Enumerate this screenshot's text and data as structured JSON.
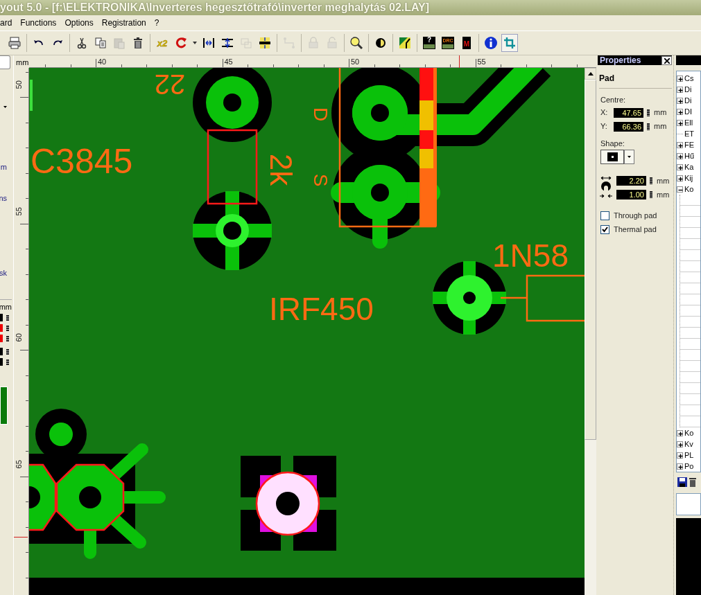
{
  "window": {
    "title": "yout 5.0 - [f:\\ELEKTRONIKA\\Inverteres hegesztőtrafó\\inverter meghalytás 02.LAY]"
  },
  "menu": [
    "ard",
    "Functions",
    "Options",
    "Registration",
    "?"
  ],
  "toolbar": {
    "groups": [
      [
        {
          "kind": "print",
          "disabled": false,
          "selected": false
        }
      ],
      [
        {
          "kind": "undo",
          "disabled": false,
          "selected": false
        },
        {
          "kind": "redo",
          "disabled": false,
          "selected": false
        }
      ],
      [
        {
          "kind": "cut",
          "disabled": false,
          "selected": false
        },
        {
          "kind": "copy",
          "disabled": false,
          "selected": false
        },
        {
          "kind": "paste",
          "disabled": true,
          "selected": false
        },
        {
          "kind": "delete",
          "disabled": false,
          "selected": false
        }
      ],
      [
        {
          "kind": "double",
          "label": "x2",
          "disabled": false,
          "selected": false
        },
        {
          "kind": "rotate",
          "disabled": false,
          "selected": false
        },
        {
          "kind": "caret",
          "disabled": false,
          "selected": false
        },
        {
          "kind": "mirror",
          "disabled": false,
          "selected": false
        },
        {
          "kind": "spread",
          "disabled": false,
          "selected": false
        },
        {
          "kind": "group",
          "disabled": true,
          "selected": false
        },
        {
          "kind": "fit",
          "disabled": false,
          "selected": false
        }
      ],
      [
        {
          "kind": "route",
          "disabled": true,
          "selected": false
        }
      ],
      [
        {
          "kind": "lock",
          "disabled": true,
          "selected": false
        },
        {
          "kind": "unlock",
          "disabled": true,
          "selected": false
        }
      ],
      [
        {
          "kind": "zoom",
          "disabled": false,
          "selected": false
        }
      ],
      [
        {
          "kind": "contrast",
          "disabled": false,
          "selected": false
        }
      ],
      [
        {
          "kind": "autoroute",
          "disabled": false,
          "selected": false
        }
      ],
      [
        {
          "kind": "test",
          "label": "?",
          "disabled": false,
          "selected": false
        },
        {
          "kind": "drc",
          "label": "DRC",
          "disabled": false,
          "selected": false
        },
        {
          "kind": "macro",
          "label": "M",
          "disabled": false,
          "selected": false
        }
      ],
      [
        {
          "kind": "info",
          "disabled": false,
          "selected": false
        },
        {
          "kind": "crop",
          "disabled": false,
          "selected": true
        }
      ]
    ]
  },
  "left_panel": {
    "texts": [
      "m",
      "ns",
      "sk"
    ],
    "unit": "mm"
  },
  "horizontal_ruler": {
    "unit": "mm",
    "labels": [
      "40",
      "45",
      "50",
      "55"
    ]
  },
  "vertical_ruler": {
    "labels": [
      "50",
      "55",
      "60",
      "65"
    ]
  },
  "board": {
    "labels": [
      {
        "text": "22"
      },
      {
        "text": "C3845"
      },
      {
        "text": "2k"
      },
      {
        "text": "D"
      },
      {
        "text": "S"
      },
      {
        "text": "IRF450"
      },
      {
        "text": "1N58"
      }
    ]
  },
  "properties": {
    "title": "Properties",
    "heading": "Pad",
    "centre_label": "Centre:",
    "x_label": "X:",
    "x_value": "47.65",
    "x_unit": "mm",
    "y_label": "Y:",
    "y_value": "66.36",
    "y_unit": "mm",
    "shape_label": "Shape:",
    "diameter_value": "2.20",
    "diameter_unit": "mm",
    "hole_value": "1.00",
    "hole_unit": "mm",
    "checkboxes": [
      {
        "label": "Through pad",
        "checked": false
      },
      {
        "label": "Thermal pad",
        "checked": true
      }
    ]
  },
  "library_tree": {
    "items": [
      {
        "label": "Cs",
        "kind": "folder",
        "expanded": false
      },
      {
        "label": "Di",
        "kind": "folder",
        "expanded": false
      },
      {
        "label": "Di",
        "kind": "folder",
        "expanded": false
      },
      {
        "label": "DI",
        "kind": "folder",
        "expanded": false
      },
      {
        "label": "Ell",
        "kind": "folder",
        "expanded": false
      },
      {
        "label": "ET",
        "kind": "leaf",
        "expanded": false
      },
      {
        "label": "FE",
        "kind": "folder",
        "expanded": false
      },
      {
        "label": "Hű",
        "kind": "folder",
        "expanded": false
      },
      {
        "label": "Ka",
        "kind": "folder",
        "expanded": false
      },
      {
        "label": "Kij",
        "kind": "folder",
        "expanded": false
      },
      {
        "label": "Ko",
        "kind": "folder",
        "expanded": true
      },
      {
        "label": "Ko",
        "kind": "folder",
        "expanded": false
      },
      {
        "label": "Kv",
        "kind": "folder",
        "expanded": false
      },
      {
        "label": "PL",
        "kind": "folder",
        "expanded": false
      },
      {
        "label": "Po",
        "kind": "folder",
        "expanded": false
      }
    ]
  }
}
